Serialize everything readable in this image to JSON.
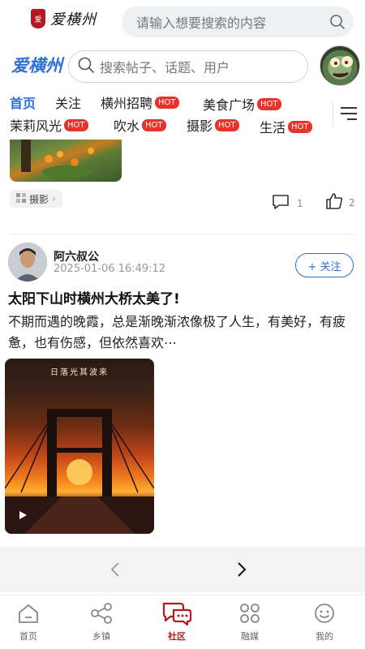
{
  "top_bar": {
    "logo_seal_text": "爱",
    "logo_text": "爱横州",
    "search_placeholder": "请输入想要搜索的内容",
    "search_icon": "search-icon"
  },
  "forum_header": {
    "brand": "爱横州",
    "search_placeholder": "搜索帖子、话题、用户",
    "avatar_icon": "zombie-avatar"
  },
  "tabs": {
    "row1": [
      {
        "label": "首页",
        "hot": false,
        "active": true
      },
      {
        "label": "关注",
        "hot": false,
        "active": false
      },
      {
        "label": "横州招聘",
        "hot": true,
        "active": false
      },
      {
        "label": "美食广场",
        "hot": true,
        "active": false
      }
    ],
    "row2": [
      {
        "label": "茉莉风光",
        "hot": true
      },
      {
        "label": "吹水",
        "hot": true
      },
      {
        "label": "摄影",
        "hot": true
      },
      {
        "label": "生活",
        "hot": true
      }
    ],
    "hot_badge": "HOT",
    "menu_icon": "menu-icon"
  },
  "prev_post": {
    "tag": "摄影",
    "comments": "1",
    "likes": "2"
  },
  "post": {
    "author": "阿六叔公",
    "time": "2025-01-06 16:49:12",
    "follow_label": "+ 关注",
    "title": "太阳下山时横州大桥太美了!",
    "body": "不期而遇的晚霞，总是渐晚渐浓像极了人生，有美好，有疲惫，也有伤感，但依然喜欢⋯",
    "image_watermark": "日落光其波来"
  },
  "browser_nav": {
    "back_icon": "chevron-left-icon",
    "forward_icon": "chevron-right-icon"
  },
  "bottom_nav": [
    {
      "label": "首页",
      "icon": "home-icon",
      "active": false
    },
    {
      "label": "乡镇",
      "icon": "share-nodes-icon",
      "active": false
    },
    {
      "label": "社区",
      "icon": "chat-bubbles-icon",
      "active": true
    },
    {
      "label": "融媒",
      "icon": "four-petal-icon",
      "active": false
    },
    {
      "label": "我的",
      "icon": "face-icon",
      "active": false
    }
  ],
  "colors": {
    "accent_blue": "#2e6fd8",
    "hot_red": "#e8332a",
    "brand_red": "#b3191e",
    "fab_blue": "#2f7cf0"
  }
}
